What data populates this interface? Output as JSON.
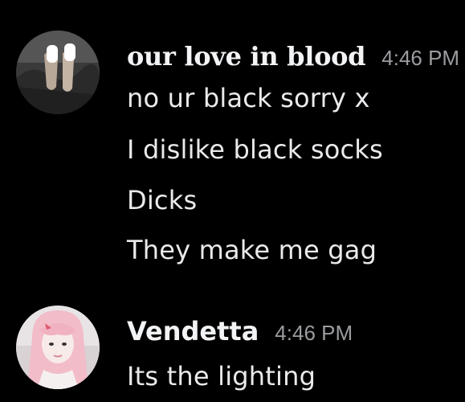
{
  "messages": [
    {
      "username": "our love in blood",
      "timestamp": "4:46 PM",
      "avatar_icon": "user-avatar-photo",
      "lines": [
        "no ur black sorry x",
        "I dislike black socks",
        "Dicks",
        "They make me gag"
      ]
    },
    {
      "username": "Vendetta",
      "timestamp": "4:46 PM",
      "avatar_icon": "user-avatar-photo",
      "lines": [
        "Its the lighting"
      ]
    }
  ],
  "colors": {
    "background": "#000000",
    "text": "#e9eaec",
    "timestamp": "#9a9ca0"
  }
}
